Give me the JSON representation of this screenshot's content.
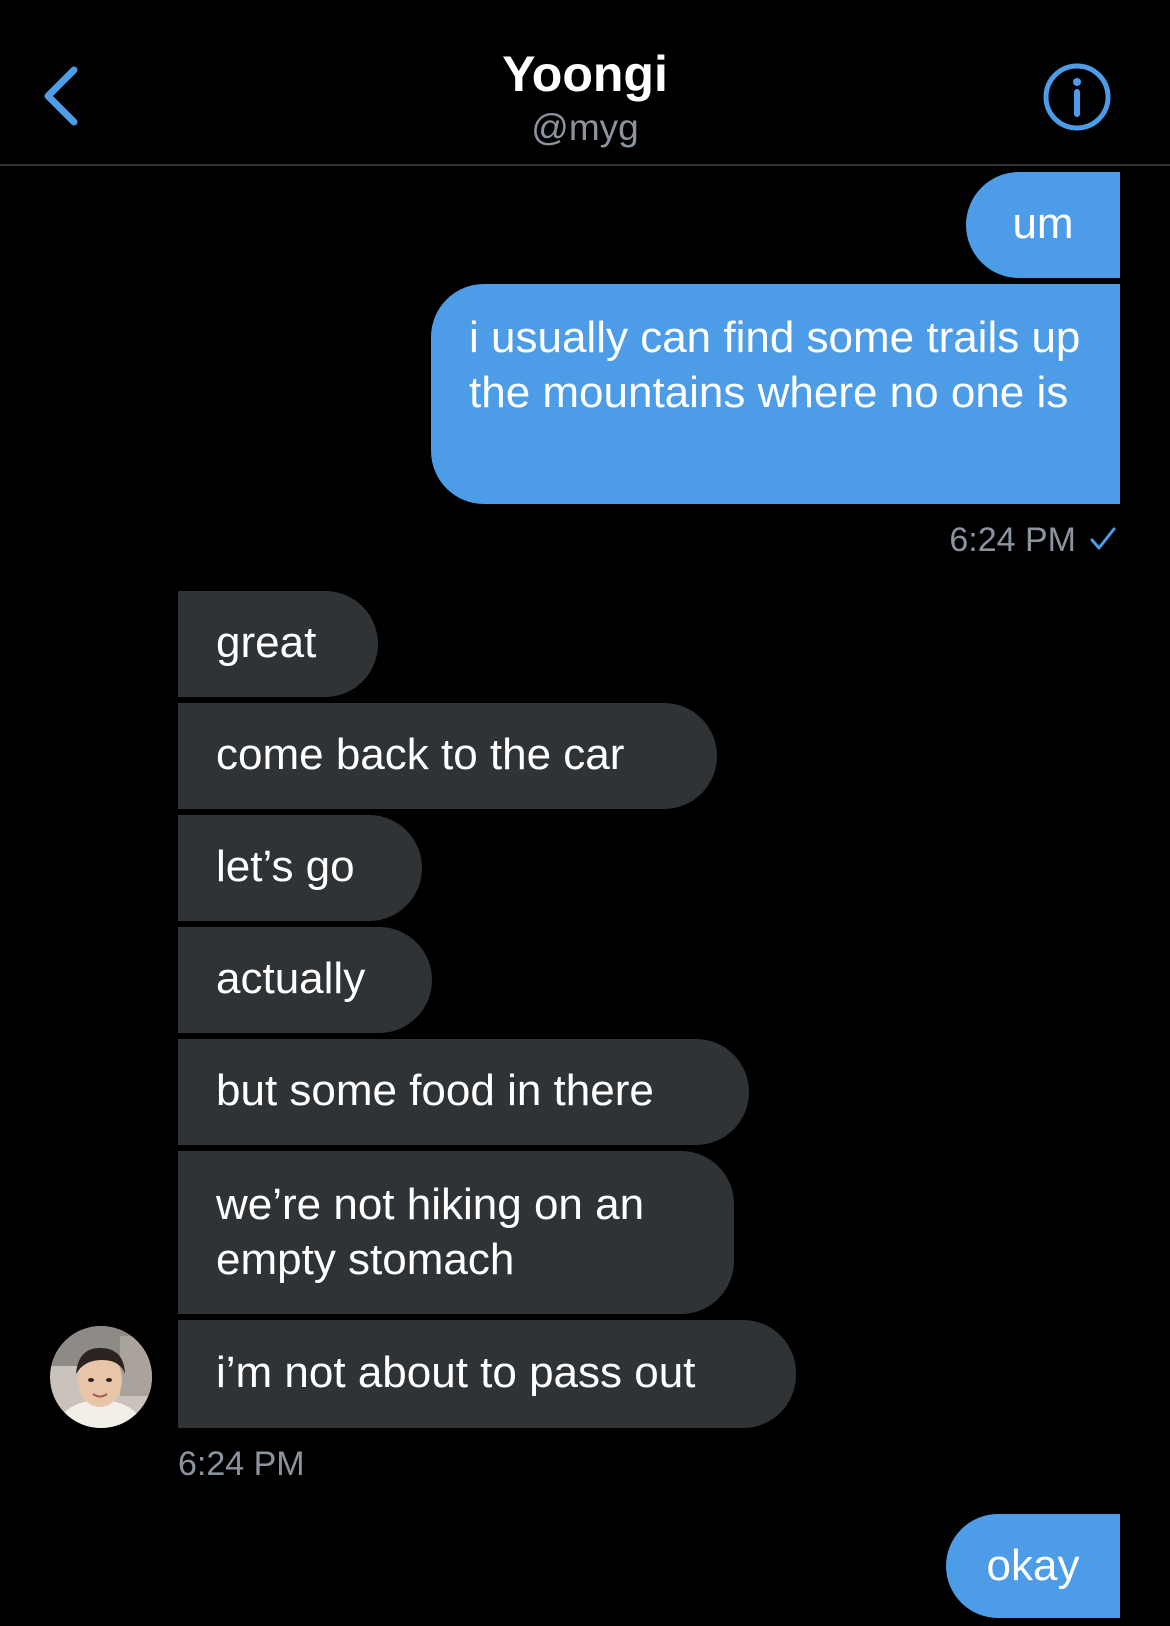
{
  "header": {
    "back_icon": "chevron-left-icon",
    "title": "Yoongi",
    "handle": "@myg",
    "info_icon": "info-icon"
  },
  "colors": {
    "accent": "#4c9ce8",
    "received_bubble": "#2f3336",
    "background": "#000000",
    "muted_text": "#8b949e"
  },
  "conversation": {
    "sent_group_1": {
      "messages": [
        "um",
        "i usually can find some trails up the mountains where no one is"
      ],
      "time": "6:24 PM",
      "status_icon": "checkmark-icon"
    },
    "received_group": {
      "messages": [
        "great",
        "come back to the car",
        "let’s go",
        "actually",
        "but some food in there",
        "we’re not hiking on an empty stomach",
        "i’m not about to pass out"
      ],
      "time": "6:24 PM",
      "avatar_icon": "profile-photo"
    },
    "sent_group_2": {
      "messages": [
        "okay"
      ]
    }
  }
}
